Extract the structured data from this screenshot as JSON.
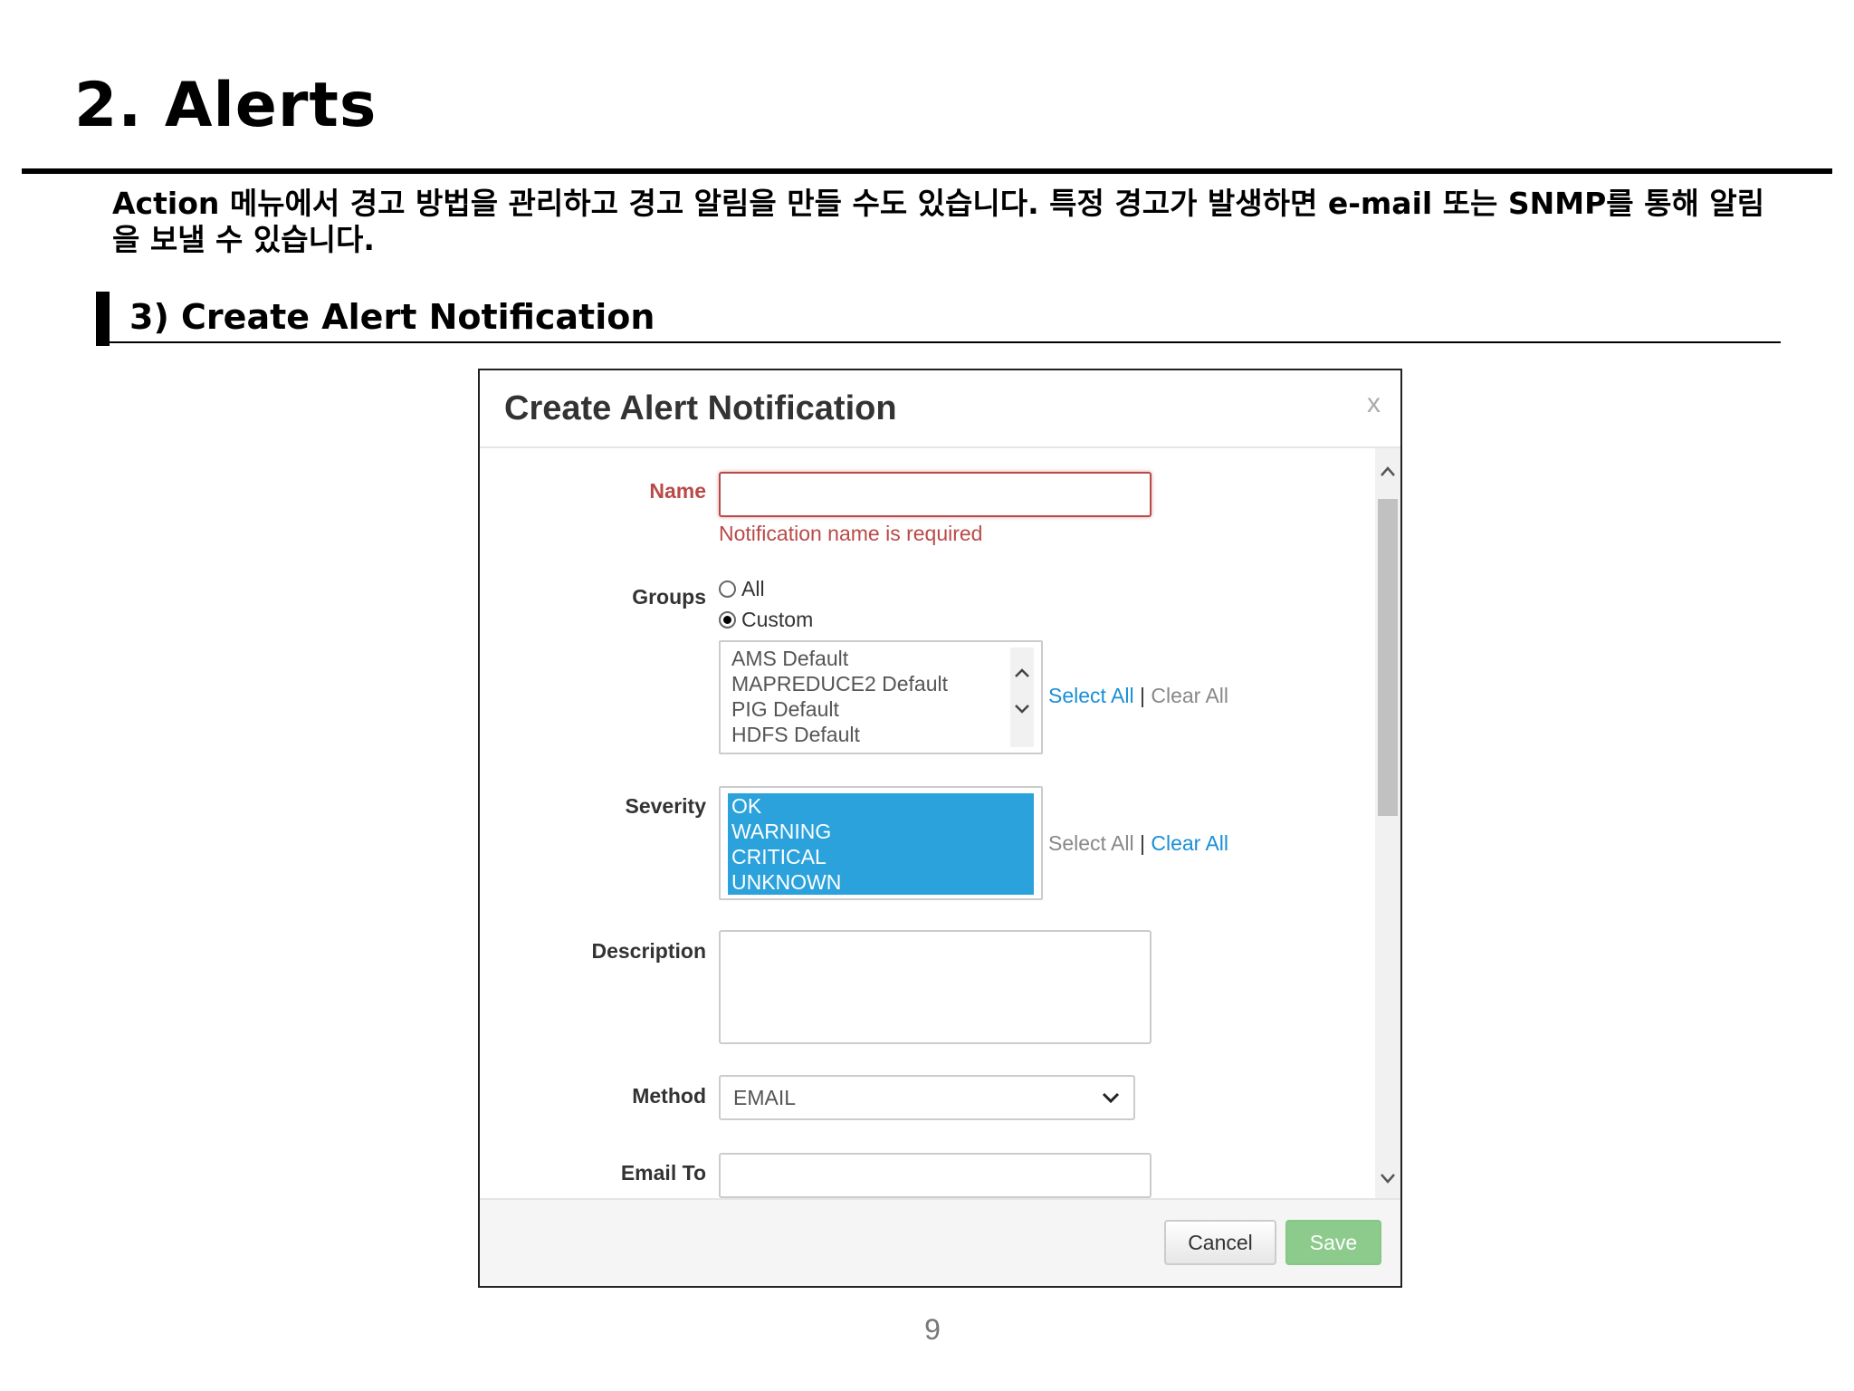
{
  "slide": {
    "title": "2. Alerts",
    "intro": "Action 메뉴에서 경고 방법을 관리하고 경고 알림을 만들 수도 있습니다. 특정 경고가 발생하면 e-mail 또는 SNMP를 통해 알림을 보낼 수 있습니다.",
    "section_title": "3) Create Alert Notification",
    "page_number": "9"
  },
  "dialog": {
    "title": "Create Alert Notification",
    "close_label": "x",
    "name": {
      "label": "Name",
      "value": "",
      "error": "Notification name is required"
    },
    "groups": {
      "label": "Groups",
      "radio_all": "All",
      "radio_custom": "Custom",
      "selected_radio": "Custom",
      "options": [
        "AMS Default",
        "MAPREDUCE2 Default",
        "PIG Default",
        "HDFS Default"
      ],
      "select_all": "Select All",
      "separator": "|",
      "clear_all": "Clear All"
    },
    "severity": {
      "label": "Severity",
      "options": [
        "OK",
        "WARNING",
        "CRITICAL",
        "UNKNOWN"
      ],
      "select_all": "Select All",
      "separator": "|",
      "clear_all": "Clear All"
    },
    "description": {
      "label": "Description",
      "value": ""
    },
    "method": {
      "label": "Method",
      "value": "EMAIL"
    },
    "email_to": {
      "label": "Email To",
      "value": ""
    },
    "buttons": {
      "cancel": "Cancel",
      "save": "Save"
    }
  },
  "colors": {
    "error": "#b94a48",
    "selection": "#2ba2dc",
    "link": "#1a8fd6",
    "save_button": "#8dcb8d"
  }
}
